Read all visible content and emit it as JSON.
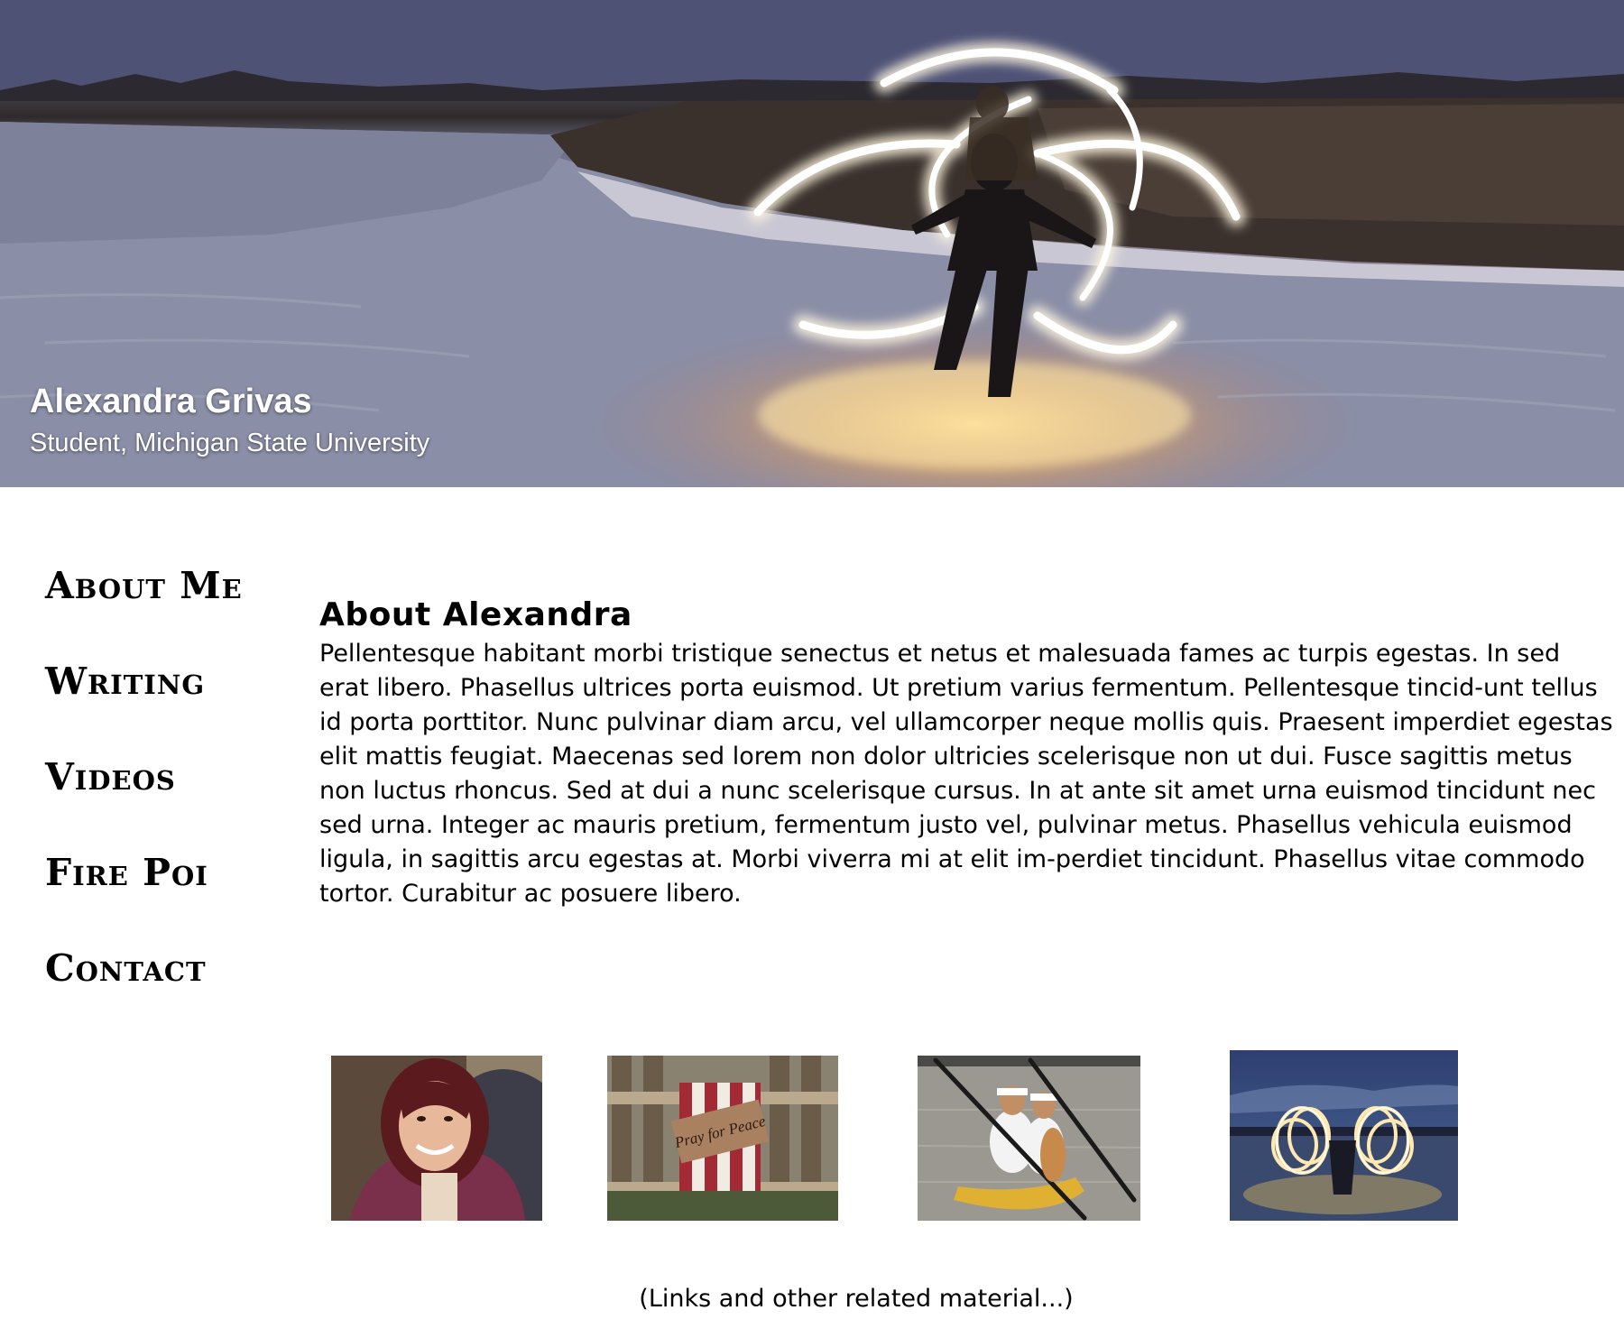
{
  "hero": {
    "name": "Alexandra Grivas",
    "subtitle": "Student, Michigan State University",
    "image_icon": "fire-poi-night-photo"
  },
  "nav": {
    "items": [
      {
        "label": "About Me"
      },
      {
        "label": "Writing"
      },
      {
        "label": "Videos"
      },
      {
        "label": "Fire Poi"
      },
      {
        "label": "Contact"
      }
    ]
  },
  "main": {
    "title": "About Alexandra",
    "body": "Pellentesque habitant morbi tristique senectus et netus et malesuada fames ac turpis egestas. In sed erat libero. Phasellus ultrices porta euismod. Ut pretium varius fermentum. Pellentesque tincid-unt tellus id porta porttitor. Nunc pulvinar diam arcu, vel ullamcorper neque mollis quis. Praesent imperdiet egestas elit mattis feugiat. Maecenas sed lorem non dolor ultricies scelerisque non ut dui. Fusce sagittis metus non luctus rhoncus. Sed at dui a nunc scelerisque cursus. In at ante sit amet urna euismod tincidunt nec sed urna. Integer ac mauris pretium, fermentum justo vel, pulvinar metus. Phasellus vehicula euismod ligula, in sagittis arcu egestas at. Morbi viverra mi at elit im-perdiet tincidunt. Phasellus vitae commodo tortor. Curabitur ac posuere libero."
  },
  "thumbnails": [
    {
      "icon": "portrait-photo"
    },
    {
      "icon": "pray-for-peace-sign-photo",
      "sign_text": "Pray for Peace"
    },
    {
      "icon": "kayaking-photo"
    },
    {
      "icon": "fire-poi-photo"
    }
  ],
  "footer": {
    "note": "(Links and other related material...)"
  },
  "colors": {
    "text": "#000000",
    "background": "#ffffff",
    "fire_glow": "#fff4d6",
    "sky": "#4b4f72"
  }
}
